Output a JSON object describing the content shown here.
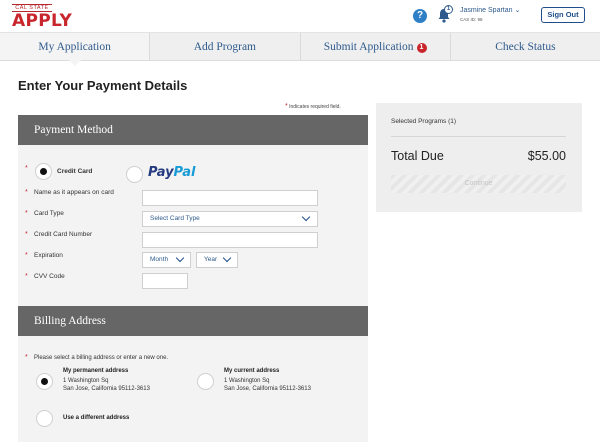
{
  "header": {
    "logo_small": "CAL STATE",
    "logo_big": "APPLY",
    "help_icon": "?",
    "notification_count": "1",
    "user_name": "Jasmine Spartan",
    "user_id": "CAS ID: 98",
    "signout_label": "Sign Out"
  },
  "nav": {
    "tabs": [
      {
        "label": "My Application",
        "active": true
      },
      {
        "label": "Add Program",
        "active": false
      },
      {
        "label": "Submit Application",
        "active": false,
        "badge": "1"
      },
      {
        "label": "Check Status",
        "active": false
      }
    ]
  },
  "page": {
    "title": "Enter Your Payment Details",
    "required_note": "Indicates required field."
  },
  "payment_method": {
    "header": "Payment Method",
    "credit_card_label": "Credit Card",
    "paypal_label_1": "Pay",
    "paypal_label_2": "Pal",
    "fields": {
      "name_label": "Name as it appears on card",
      "card_type_label": "Card Type",
      "card_type_value": "Select Card Type",
      "card_number_label": "Credit Card Number",
      "expiration_label": "Expiration",
      "month_value": "Month",
      "year_value": "Year",
      "cvv_label": "CVV Code"
    }
  },
  "billing_address": {
    "header": "Billing Address",
    "instruction": "Please select a billing address or enter a new one.",
    "permanent": {
      "title": "My permanent address",
      "line1": "1 Washington Sq",
      "line2": "San Jose, California 95112-3613"
    },
    "current": {
      "title": "My current address",
      "line1": "1 Washington Sq",
      "line2": "San Jose, California 95112-3613"
    },
    "different_label": "Use a different address"
  },
  "summary": {
    "selected_programs": "Selected Programs (1)",
    "total_label": "Total Due",
    "total_value": "$55.00",
    "continue_label": "Continue"
  },
  "colors": {
    "brand_red": "#c8262c",
    "link_blue": "#2e5a8c",
    "panel_gray": "#666666"
  }
}
